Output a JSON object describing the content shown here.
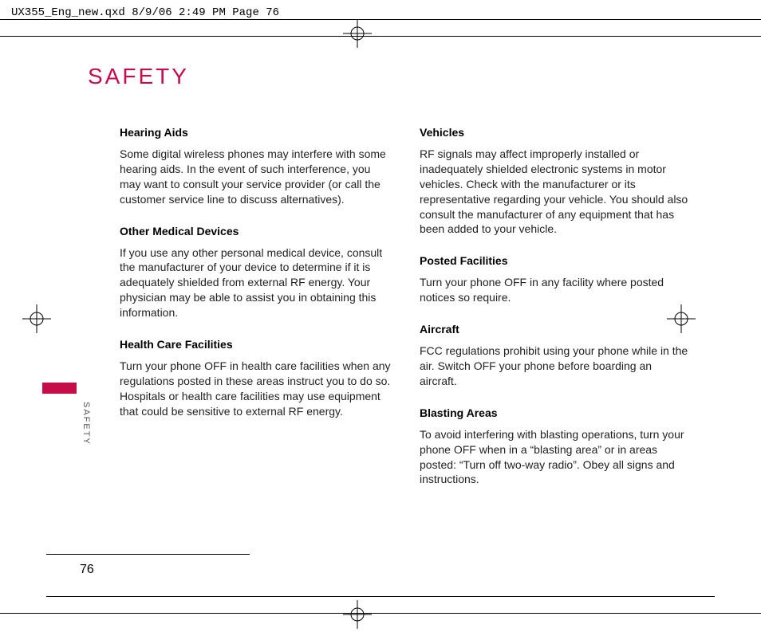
{
  "print_header": "UX355_Eng_new.qxd  8/9/06  2:49 PM  Page 76",
  "title": "SAFETY",
  "side_tab": "SAFETY",
  "page_number": "76",
  "left_column": [
    {
      "heading": "Hearing Aids",
      "body": "Some digital wireless phones may interfere with some hearing aids. In the event of such interference, you may want to consult your service provider (or call the customer service line to discuss alternatives)."
    },
    {
      "heading": "Other Medical Devices",
      "body": "If you use any other personal medical device, consult the manufacturer of your device to determine if it is adequately shielded from external RF energy. Your physician may be able to assist you in obtaining this information."
    },
    {
      "heading": "Health Care Facilities",
      "body": "Turn your phone OFF in health care facilities when any regulations posted in these areas instruct you to do so. Hospitals or health care facilities may use equipment that could be sensitive to external RF energy."
    }
  ],
  "right_column": [
    {
      "heading": "Vehicles",
      "body": "RF signals may affect improperly installed or inadequately shielded electronic systems in motor vehicles. Check with the manufacturer or its representative regarding your vehicle.  You should also consult the manufacturer of any equipment that has been added to your vehicle."
    },
    {
      "heading": "Posted Facilities",
      "body": "Turn your phone OFF in any facility where posted notices so require."
    },
    {
      "heading": "Aircraft",
      "body": "FCC regulations prohibit using your phone while in the air. Switch OFF your phone before boarding an aircraft."
    },
    {
      "heading": "Blasting Areas",
      "body": "To avoid interfering with blasting operations, turn your phone OFF when in a “blasting area” or in areas posted: “Turn off two-way radio”. Obey all signs and instructions."
    }
  ]
}
